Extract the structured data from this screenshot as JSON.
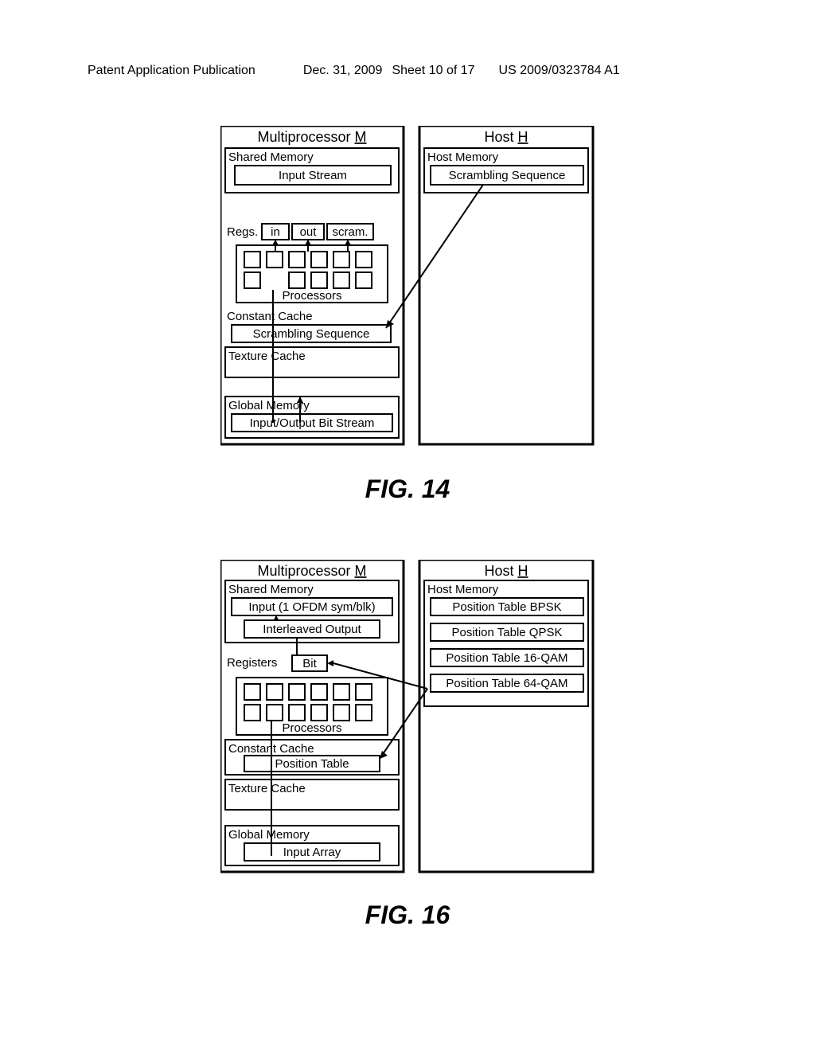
{
  "header": {
    "left": "Patent Application Publication",
    "date": "Dec. 31, 2009",
    "sheet": "Sheet 10 of 17",
    "pubno": "US 2009/0323784 A1"
  },
  "fig14": {
    "caption": "FIG. 14",
    "mp": {
      "title_prefix": "Multiprocessor ",
      "title_u": "M",
      "shared_mem": "Shared Memory",
      "input_stream": "Input Stream",
      "regs": "Regs.",
      "in": "in",
      "out": "out",
      "scram": "scram.",
      "processors": "Processors",
      "const_cache": "Constant Cache",
      "scrambling_seq": "Scrambling Sequence",
      "texture_cache": "Texture Cache",
      "global_mem": "Global Memory",
      "iobs": "Input/Output Bit Stream"
    },
    "host": {
      "title_prefix": "Host ",
      "title_u": "H",
      "host_mem": "Host Memory",
      "scrambling_seq": "Scrambling Sequence"
    }
  },
  "fig16": {
    "caption": "FIG. 16",
    "mp": {
      "title_prefix": "Multiprocessor ",
      "title_u": "M",
      "shared_mem": "Shared Memory",
      "input": "Input (1 OFDM sym/blk)",
      "interleaved": "Interleaved Output",
      "registers": "Registers",
      "bit": "Bit",
      "processors": "Processors",
      "const_cache": "Constant Cache",
      "pos_table": "Position Table",
      "texture_cache": "Texture Cache",
      "global_mem": "Global Memory",
      "input_array": "Input Array"
    },
    "host": {
      "title_prefix": "Host ",
      "title_u": "H",
      "host_mem": "Host Memory",
      "pt_bpsk": "Position Table  BPSK",
      "pt_qpsk": "Position Table  QPSK",
      "pt_16": "Position Table  16-QAM",
      "pt_64": "Position Table  64-QAM"
    }
  }
}
